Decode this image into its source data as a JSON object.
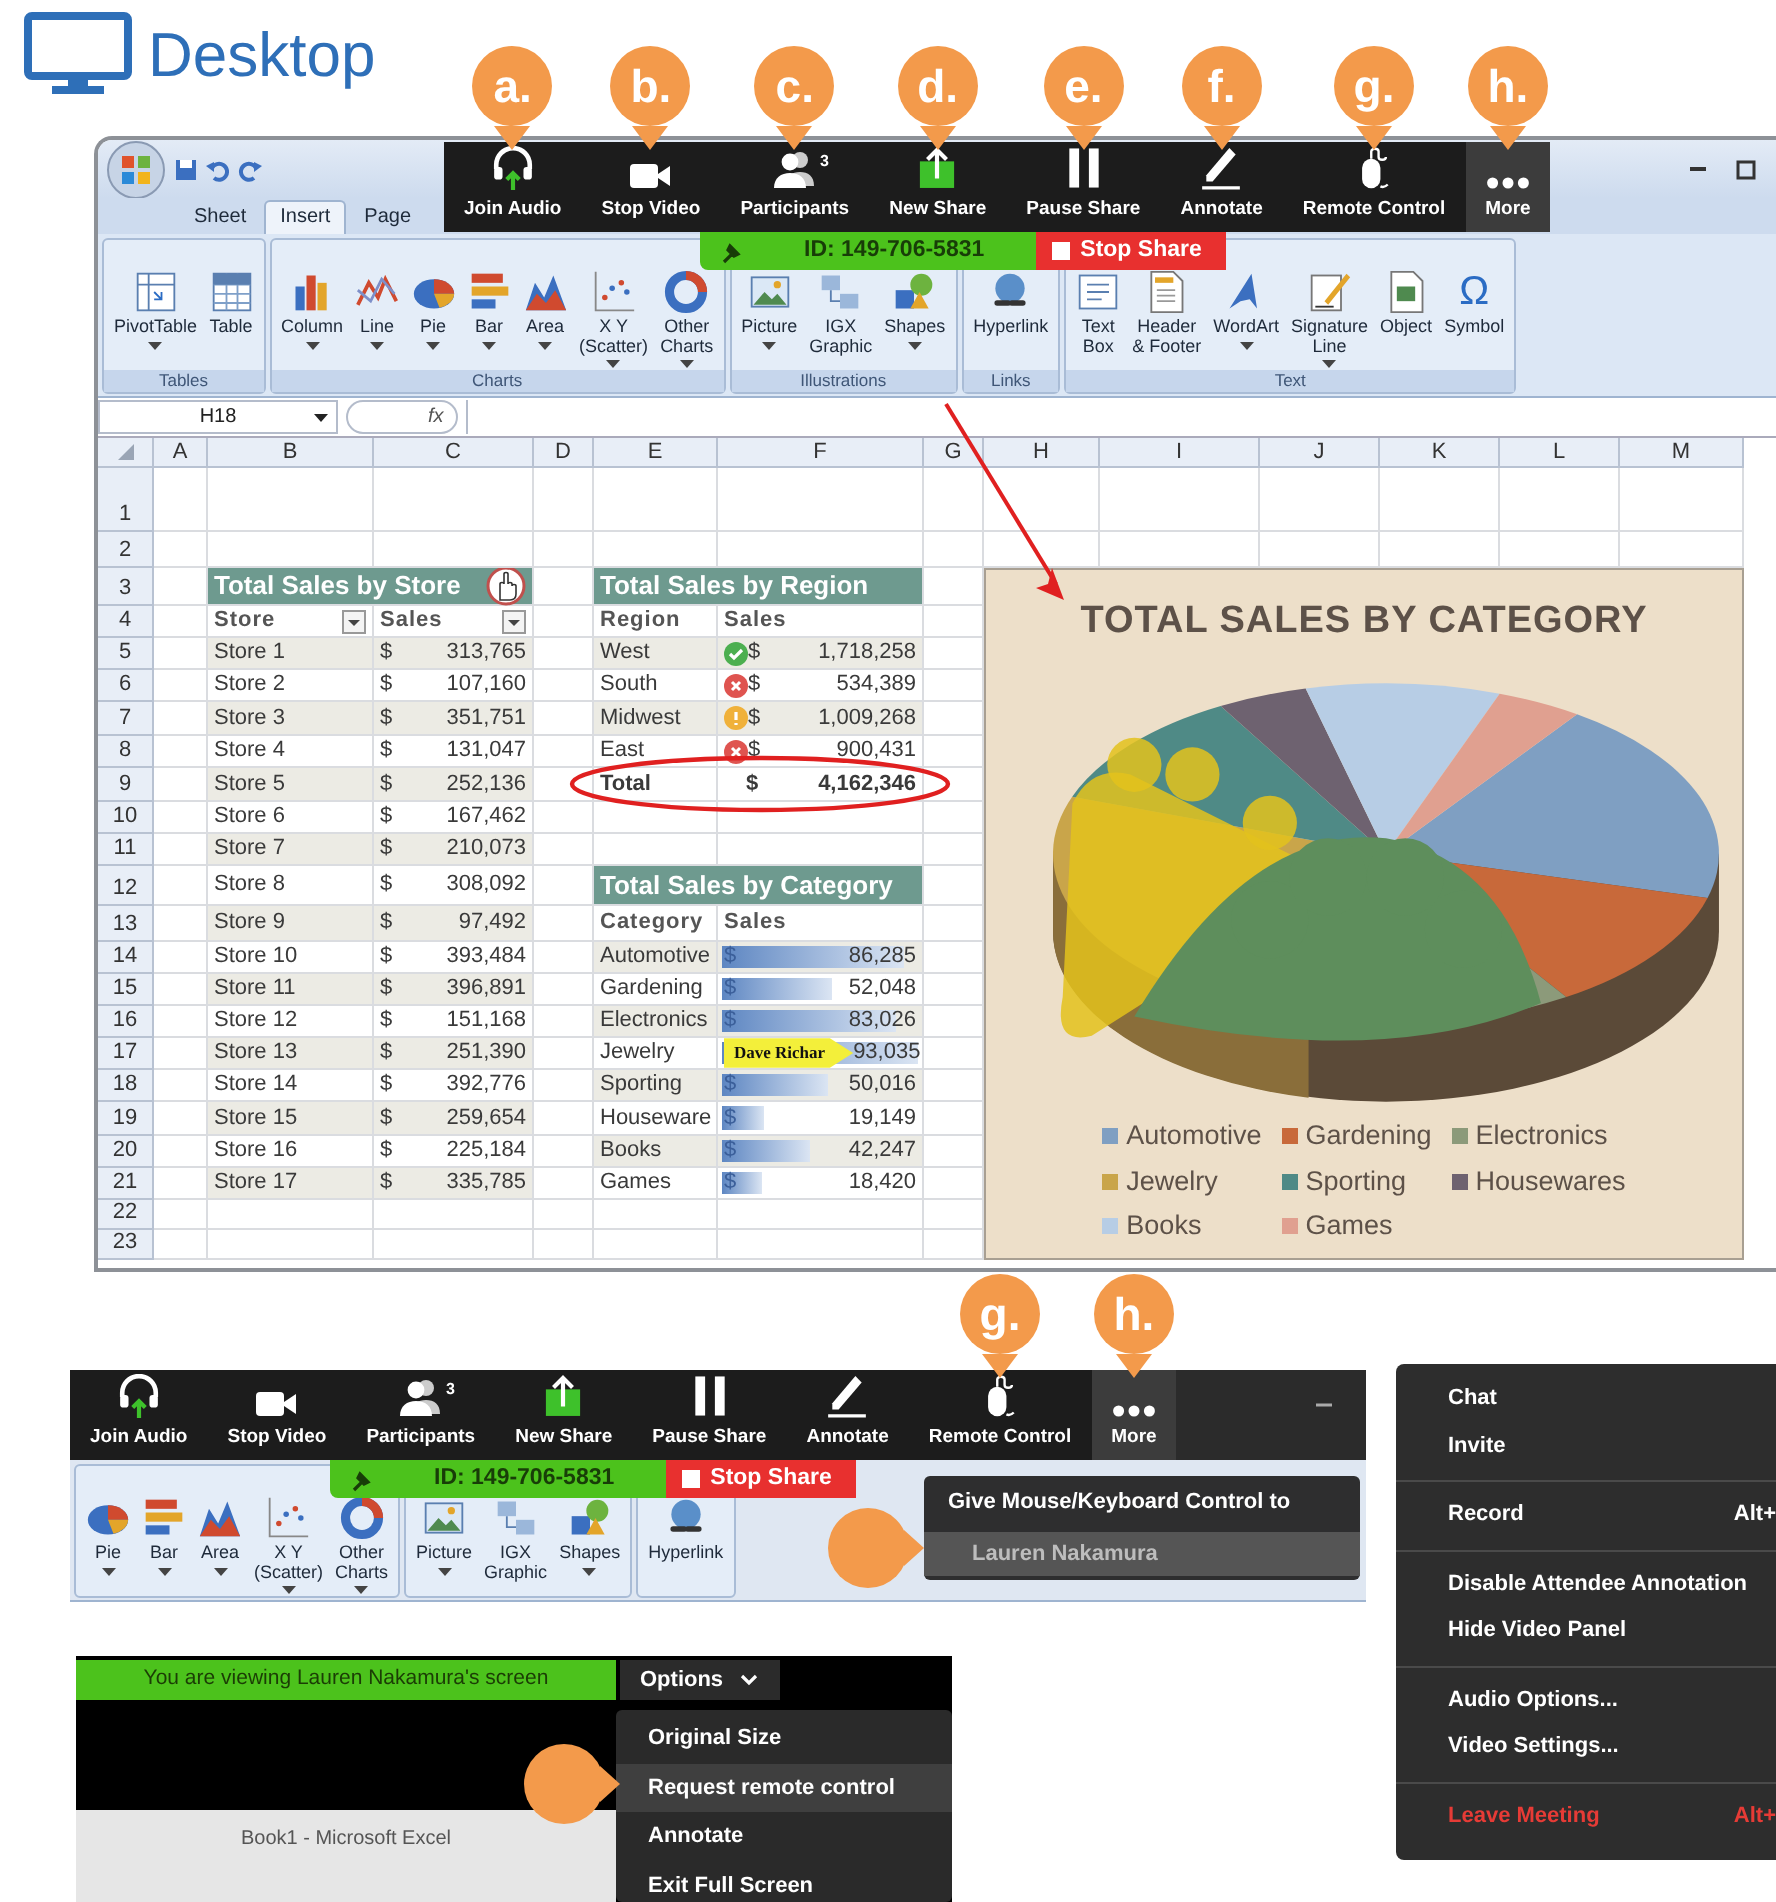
{
  "header": {
    "title": "Desktop"
  },
  "excel": {
    "tabs": [
      {
        "label": "Sheet",
        "selected": false
      },
      {
        "label": "Insert",
        "selected": true
      },
      {
        "label": "Page",
        "selected": false
      }
    ],
    "ribbon": [
      {
        "name": "Tables",
        "items": [
          {
            "kind": "pivot",
            "lines": [
              "PivotTable"
            ],
            "dropdown": true
          },
          {
            "kind": "table",
            "lines": [
              "Table"
            ],
            "dropdown": false
          }
        ]
      },
      {
        "name": "Charts",
        "items": [
          {
            "kind": "column",
            "lines": [
              "Column"
            ],
            "dropdown": true
          },
          {
            "kind": "line",
            "lines": [
              "Line"
            ],
            "dropdown": true
          },
          {
            "kind": "pie",
            "lines": [
              "Pie"
            ],
            "dropdown": true
          },
          {
            "kind": "bar",
            "lines": [
              "Bar"
            ],
            "dropdown": true
          },
          {
            "kind": "area",
            "lines": [
              "Area"
            ],
            "dropdown": true
          },
          {
            "kind": "scatter",
            "lines": [
              "X Y",
              "(Scatter)"
            ],
            "dropdown": true
          },
          {
            "kind": "other",
            "lines": [
              "Other",
              "Charts"
            ],
            "dropdown": true
          }
        ]
      },
      {
        "name": "Illustrations",
        "items": [
          {
            "kind": "picture",
            "lines": [
              "Picture"
            ],
            "dropdown": true
          },
          {
            "kind": "graphic",
            "lines": [
              "IGX",
              "Graphic"
            ],
            "dropdown": false
          },
          {
            "kind": "shapes",
            "lines": [
              "Shapes"
            ],
            "dropdown": true
          }
        ]
      },
      {
        "name": "Links",
        "items": [
          {
            "kind": "hyperlink",
            "lines": [
              "Hyperlink"
            ],
            "dropdown": false
          }
        ]
      },
      {
        "name": "Text",
        "items": [
          {
            "kind": "textbox",
            "lines": [
              "Text",
              "Box"
            ],
            "dropdown": false
          },
          {
            "kind": "header",
            "lines": [
              "Header",
              "& Footer"
            ],
            "dropdown": false
          },
          {
            "kind": "wordart",
            "lines": [
              "WordArt"
            ],
            "dropdown": true
          },
          {
            "kind": "signature",
            "lines": [
              "Signature",
              "Line"
            ],
            "dropdown": true
          },
          {
            "kind": "object",
            "lines": [
              "Object"
            ],
            "dropdown": false
          },
          {
            "kind": "glyph",
            "glyph": "Ω",
            "lines": [
              "Symbol"
            ],
            "dropdown": false
          }
        ]
      }
    ],
    "name_box": "H18",
    "function_label": "fx",
    "columns": [
      "A",
      "B",
      "C",
      "D",
      "E",
      "F",
      "G",
      "H",
      "I",
      "J",
      "K",
      "L",
      "M"
    ],
    "row_numbers": [
      "1",
      "2",
      "3",
      "4",
      "5",
      "6",
      "7",
      "8",
      "9",
      "10",
      "11",
      "12",
      "13",
      "14",
      "15",
      "16",
      "17",
      "18",
      "19",
      "20",
      "21",
      "22",
      "23"
    ],
    "store_table": {
      "title": "Total Sales by Store",
      "headers": [
        "Store",
        "Sales"
      ],
      "rows": [
        {
          "store": "Store 1",
          "currency": "$",
          "sales": "313,765"
        },
        {
          "store": "Store 2",
          "currency": "$",
          "sales": "107,160"
        },
        {
          "store": "Store 3",
          "currency": "$",
          "sales": "351,751"
        },
        {
          "store": "Store 4",
          "currency": "$",
          "sales": "131,047"
        },
        {
          "store": "Store 5",
          "currency": "$",
          "sales": "252,136"
        },
        {
          "store": "Store 6",
          "currency": "$",
          "sales": "167,462"
        },
        {
          "store": "Store 7",
          "currency": "$",
          "sales": "210,073"
        },
        {
          "store": "Store 8",
          "currency": "$",
          "sales": "308,092"
        },
        {
          "store": "Store 9",
          "currency": "$",
          "sales": "97,492"
        },
        {
          "store": "Store 10",
          "currency": "$",
          "sales": "393,484"
        },
        {
          "store": "Store 11",
          "currency": "$",
          "sales": "396,891"
        },
        {
          "store": "Store 12",
          "currency": "$",
          "sales": "151,168"
        },
        {
          "store": "Store 13",
          "currency": "$",
          "sales": "251,390"
        },
        {
          "store": "Store 14",
          "currency": "$",
          "sales": "392,776"
        },
        {
          "store": "Store 15",
          "currency": "$",
          "sales": "259,654"
        },
        {
          "store": "Store 16",
          "currency": "$",
          "sales": "225,184"
        },
        {
          "store": "Store 17",
          "currency": "$",
          "sales": "335,785"
        }
      ]
    },
    "region_table": {
      "title": "Total Sales by Region",
      "headers": [
        "Region",
        "Sales"
      ],
      "rows": [
        {
          "region": "West",
          "kind": "good",
          "currency": "$",
          "sales": "1,718,258"
        },
        {
          "region": "South",
          "kind": "bad",
          "currency": "$",
          "sales": "534,389"
        },
        {
          "region": "Midwest",
          "kind": "warn",
          "currency": "$",
          "sales": "1,009,268"
        },
        {
          "region": "East",
          "kind": "bad",
          "currency": "$",
          "sales": "900,431"
        }
      ],
      "total": {
        "label": "Total",
        "currency": "$",
        "sales": "4,162,346"
      }
    },
    "category_table": {
      "title": "Total Sales by Category",
      "headers": [
        "Category",
        "Sales"
      ],
      "rows": [
        {
          "category": "Automotive",
          "currency": "$",
          "sales": "86,285",
          "level": 0.93
        },
        {
          "category": "Gardening",
          "currency": "$",
          "sales": "52,048",
          "level": 0.56
        },
        {
          "category": "Electronics",
          "currency": "$",
          "sales": "83,026",
          "level": 0.89
        },
        {
          "category": "Jewelry",
          "cursor_tag": "Dave Richar",
          "sales": "93,035",
          "level": 1.0
        },
        {
          "category": "Sporting",
          "currency": "$",
          "sales": "50,016",
          "level": 0.54
        },
        {
          "category": "Houseware",
          "currency": "$",
          "sales": "19,149",
          "level": 0.21
        },
        {
          "category": "Books",
          "currency": "$",
          "sales": "42,247",
          "level": 0.45
        },
        {
          "category": "Games",
          "currency": "$",
          "sales": "18,420",
          "level": 0.2
        }
      ]
    },
    "chart": {
      "title": "TOTAL SALES BY CATEGORY",
      "legend": [
        {
          "label": "Automotive",
          "color": "#7f9fc2"
        },
        {
          "label": "Gardening",
          "color": "#c8693a"
        },
        {
          "label": "Electronics",
          "color": "#8c9a7a"
        },
        {
          "label": "Jewelry",
          "color": "#c9a54a"
        },
        {
          "label": "Sporting",
          "color": "#4f8a86"
        },
        {
          "label": "Housewares",
          "color": "#6e6270"
        },
        {
          "label": "Books",
          "color": "#b7cde5"
        },
        {
          "label": "Games",
          "color": "#e0a090"
        }
      ]
    }
  },
  "zoom_toolbar": {
    "buttons": [
      {
        "kind": "headphones",
        "label": "Join Audio",
        "marker": "a.",
        "selected": false
      },
      {
        "kind": "camera",
        "label": "Stop Video",
        "marker": "b.",
        "selected": false
      },
      {
        "kind": "people",
        "label": "Participants",
        "badge": "3",
        "marker": "c.",
        "selected": false
      },
      {
        "kind": "share",
        "label": "New Share",
        "marker": "d.",
        "selected": false
      },
      {
        "kind": "pause",
        "label": "Pause Share",
        "marker": "e.",
        "selected": false
      },
      {
        "kind": "pencil",
        "label": "Annotate",
        "marker": "f.",
        "selected": false
      },
      {
        "kind": "mouse",
        "label": "Remote Control",
        "marker": "g.",
        "selected": false
      },
      {
        "kind": "dots",
        "label": "More",
        "marker": "h.",
        "selected": true
      }
    ],
    "meeting_id": "ID: 149-706-5831",
    "stop_label": "Stop Share"
  },
  "remote_panel": {
    "buttons": [
      {
        "kind": "headphones",
        "label": "Join Audio",
        "selected": false
      },
      {
        "kind": "camera",
        "label": "Stop Video",
        "selected": false
      },
      {
        "kind": "people",
        "label": "Participants",
        "badge": "3",
        "selected": false
      },
      {
        "kind": "share",
        "label": "New Share",
        "selected": false
      },
      {
        "kind": "pause",
        "label": "Pause Share",
        "selected": false
      },
      {
        "kind": "pencil",
        "label": "Annotate",
        "selected": false
      },
      {
        "kind": "mouse",
        "label": "Remote Control",
        "marker": "g.",
        "selected": false
      },
      {
        "kind": "dots",
        "label": "More",
        "marker": "h.",
        "selected": true
      }
    ],
    "meeting_id": "ID: 149-706-5831",
    "stop_label": "Stop Share",
    "ribbon": [
      {
        "items": [
          {
            "kind": "pie",
            "lines": [
              "Pie"
            ],
            "dropdown": true
          },
          {
            "kind": "bar",
            "lines": [
              "Bar"
            ],
            "dropdown": true
          },
          {
            "kind": "area",
            "lines": [
              "Area"
            ],
            "dropdown": true
          },
          {
            "kind": "scatter",
            "lines": [
              "X Y",
              "(Scatter)"
            ],
            "dropdown": true
          },
          {
            "kind": "other",
            "lines": [
              "Other",
              "Charts"
            ],
            "dropdown": true
          }
        ]
      },
      {
        "items": [
          {
            "kind": "picture",
            "lines": [
              "Picture"
            ],
            "dropdown": true
          },
          {
            "kind": "graphic",
            "lines": [
              "IGX",
              "Graphic"
            ],
            "dropdown": false
          },
          {
            "kind": "shapes",
            "lines": [
              "Shapes"
            ],
            "dropdown": true
          }
        ]
      },
      {
        "items": [
          {
            "kind": "hyperlink",
            "lines": [
              "Hyperlink"
            ],
            "dropdown": false
          }
        ]
      }
    ],
    "dropdown": {
      "title": "Give Mouse/Keyboard Control to",
      "items": [
        {
          "label": "Lauren Nakamura",
          "selected": true
        }
      ]
    },
    "pointer": true
  },
  "viewer_panel": {
    "banner": "You are viewing Lauren Nakamura's screen",
    "options_label": "Options",
    "window_title": "Book1 - Microsoft Excel",
    "menu": [
      {
        "label": "Original Size",
        "selected": false
      },
      {
        "label": "Request remote control",
        "selected": true
      },
      {
        "label": "Annotate",
        "selected": false
      },
      {
        "label": "Exit Full Screen",
        "selected": false
      }
    ],
    "pointer": true
  },
  "more_menu": {
    "sections": [
      [
        {
          "label": "Chat",
          "kind": "normal"
        },
        {
          "label": "Invite",
          "kind": "normal"
        }
      ],
      [
        {
          "label": "Record",
          "shortcut": "Alt+",
          "kind": "normal"
        }
      ],
      [
        {
          "label": "Disable Attendee Annotation",
          "kind": "normal"
        },
        {
          "label": "Hide Video Panel",
          "kind": "normal"
        }
      ],
      [
        {
          "label": "Audio Options...",
          "kind": "normal"
        },
        {
          "label": "Video Settings...",
          "kind": "normal"
        }
      ],
      [
        {
          "label": "Leave Meeting",
          "shortcut": "Alt+",
          "kind": "danger"
        }
      ]
    ]
  }
}
